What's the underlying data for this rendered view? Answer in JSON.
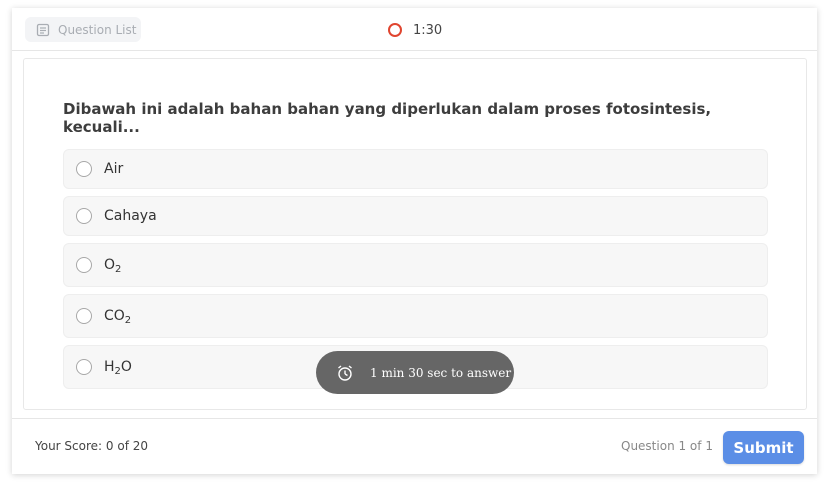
{
  "header": {
    "question_list_label": "Question List",
    "timer": "1:30"
  },
  "question": {
    "text": "Dibawah ini adalah bahan bahan yang diperlukan dalam proses fotosintesis, kecuali...",
    "options": [
      {
        "parts": [
          {
            "t": "Air"
          }
        ]
      },
      {
        "parts": [
          {
            "t": "Cahaya"
          }
        ]
      },
      {
        "parts": [
          {
            "t": "O"
          },
          {
            "sub": "2"
          }
        ]
      },
      {
        "parts": [
          {
            "t": "CO"
          },
          {
            "sub": "2"
          }
        ]
      },
      {
        "parts": [
          {
            "t": "H"
          },
          {
            "sub": "2"
          },
          {
            "t": "O"
          }
        ]
      }
    ]
  },
  "toast": {
    "text": "1 min 30 sec to answer"
  },
  "footer": {
    "score": "Your Score: 0 of 20",
    "question_count": "Question 1 of 1",
    "submit_label": "Submit"
  },
  "colors": {
    "accent": "#5b8ee6",
    "timer_ring": "#e0452f",
    "toast_bg": "#666666"
  },
  "icons": {
    "question_list": "list-icon",
    "toast": "alarm-clock-icon"
  }
}
